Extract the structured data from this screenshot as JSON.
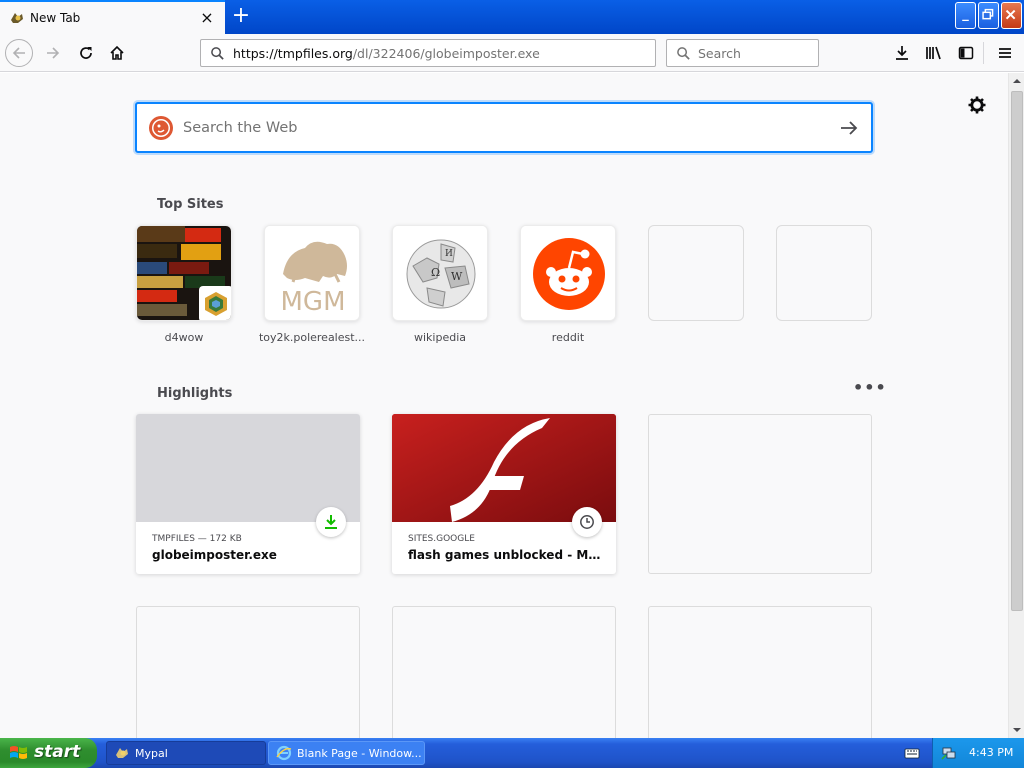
{
  "window": {
    "tab_title": "New Tab",
    "tab_close": "×",
    "new_tab": "+"
  },
  "toolbar": {
    "url_domain": "https://tmpfiles.org",
    "url_path": "/dl/322406/globeimposter.exe",
    "search_placeholder": "Search"
  },
  "newtab": {
    "search_placeholder": "Search the Web",
    "top_sites_title": "Top Sites",
    "highlights_title": "Highlights",
    "highlights_more": "•••",
    "top_sites": [
      {
        "label": "d4wow"
      },
      {
        "label": "toy2k.polerealest..."
      },
      {
        "label": "wikipedia"
      },
      {
        "label": "reddit"
      },
      {
        "label": ""
      },
      {
        "label": ""
      }
    ],
    "highlights": [
      {
        "meta": "TMPFILES — 172 KB",
        "title": "globeimposter.exe",
        "badge": "download-icon"
      },
      {
        "meta": "SITES.GOOGLE",
        "title": "flash games unblocked - Madnes...",
        "badge": "clock-icon"
      }
    ]
  },
  "taskbar": {
    "start_label": "start",
    "tasks": [
      {
        "label": "Mypal"
      },
      {
        "label": "Blank Page - Window..."
      }
    ],
    "clock": "4:43 PM"
  },
  "colors": {
    "accent": "#0a84ff",
    "reddit": "#ff4500",
    "flash_red": "#b0171a",
    "download_green": "#12bc00",
    "xp_blue": "#245edb",
    "xp_start_green": "#2f8e2f"
  }
}
